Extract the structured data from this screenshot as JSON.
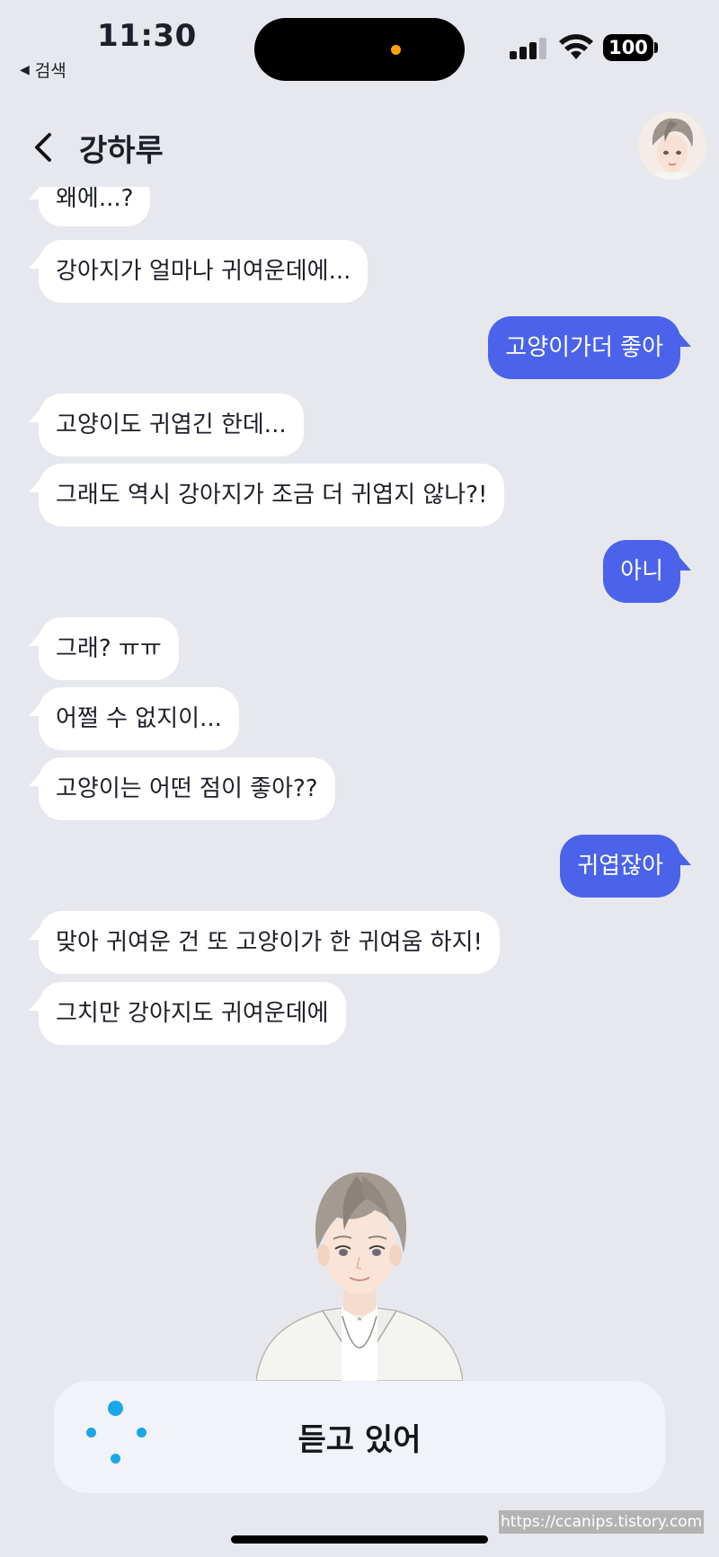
{
  "status_bar": {
    "time": "11:30",
    "back_app": "검색",
    "battery": "100"
  },
  "header": {
    "contact_name": "강하루"
  },
  "messages": [
    {
      "side": "in",
      "text": "왜에...?"
    },
    {
      "side": "in",
      "text": "강아지가 얼마나 귀여운데에..."
    },
    {
      "side": "out",
      "text": "고양이가더 좋아"
    },
    {
      "side": "in",
      "text": "고양이도 귀엽긴 한데..."
    },
    {
      "side": "in",
      "text": "그래도 역시 강아지가 조금 더 귀엽지 않나?!"
    },
    {
      "side": "out",
      "text": "아니"
    },
    {
      "side": "in",
      "text": "그래? ㅠㅠ"
    },
    {
      "side": "in",
      "text": "어쩔 수 없지이..."
    },
    {
      "side": "in",
      "text": "고양이는 어떤 점이 좋아??"
    },
    {
      "side": "out",
      "text": "귀엽잖아"
    },
    {
      "side": "in",
      "text": "맞아 귀여운 건 또 고양이가 한 귀여움 하지!"
    },
    {
      "side": "in",
      "text": "그치만 강아지도 귀여운데에"
    }
  ],
  "listening": {
    "label": "듣고 있어"
  },
  "watermark": "https://ccanips.tistory.com",
  "colors": {
    "background": "#e7e8ee",
    "incoming_bubble": "#ffffff",
    "outgoing_bubble": "#4a63ea",
    "listening_dots": "#1aa7e9",
    "mic_indicator": "#ff9f0a"
  }
}
